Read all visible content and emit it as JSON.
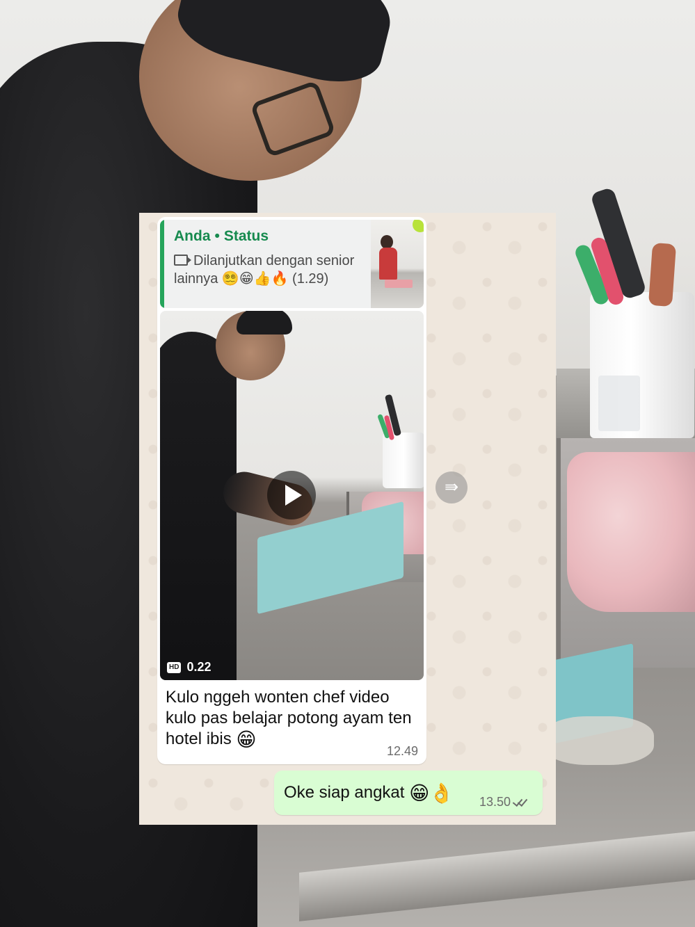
{
  "reply_quote": {
    "author": "Anda",
    "separator": "•",
    "source": "Status",
    "icon": "video-camera-icon",
    "text": "Dilanjutkan dengan senior lainnya 😵‍💫😁👍🔥 (1.29)"
  },
  "video_message": {
    "hd_badge": "HD",
    "duration": "0.22",
    "play_icon": "play-icon"
  },
  "incoming_message": {
    "text": "Kulo nggeh wonten chef video kulo pas belajar potong ayam ten hotel ibis",
    "emoji": "😁",
    "time": "12.49"
  },
  "outgoing_message": {
    "text": "Oke siap angkat",
    "emoji": "😁👌",
    "time": "13.50",
    "status_icon": "double-check-icon"
  },
  "forward_icon": "forward-icon",
  "colors": {
    "accent_green": "#168a4e",
    "quote_bar": "#25a45a",
    "outgoing_bubble": "#d9fdd3",
    "chat_background": "#efe7dd"
  }
}
